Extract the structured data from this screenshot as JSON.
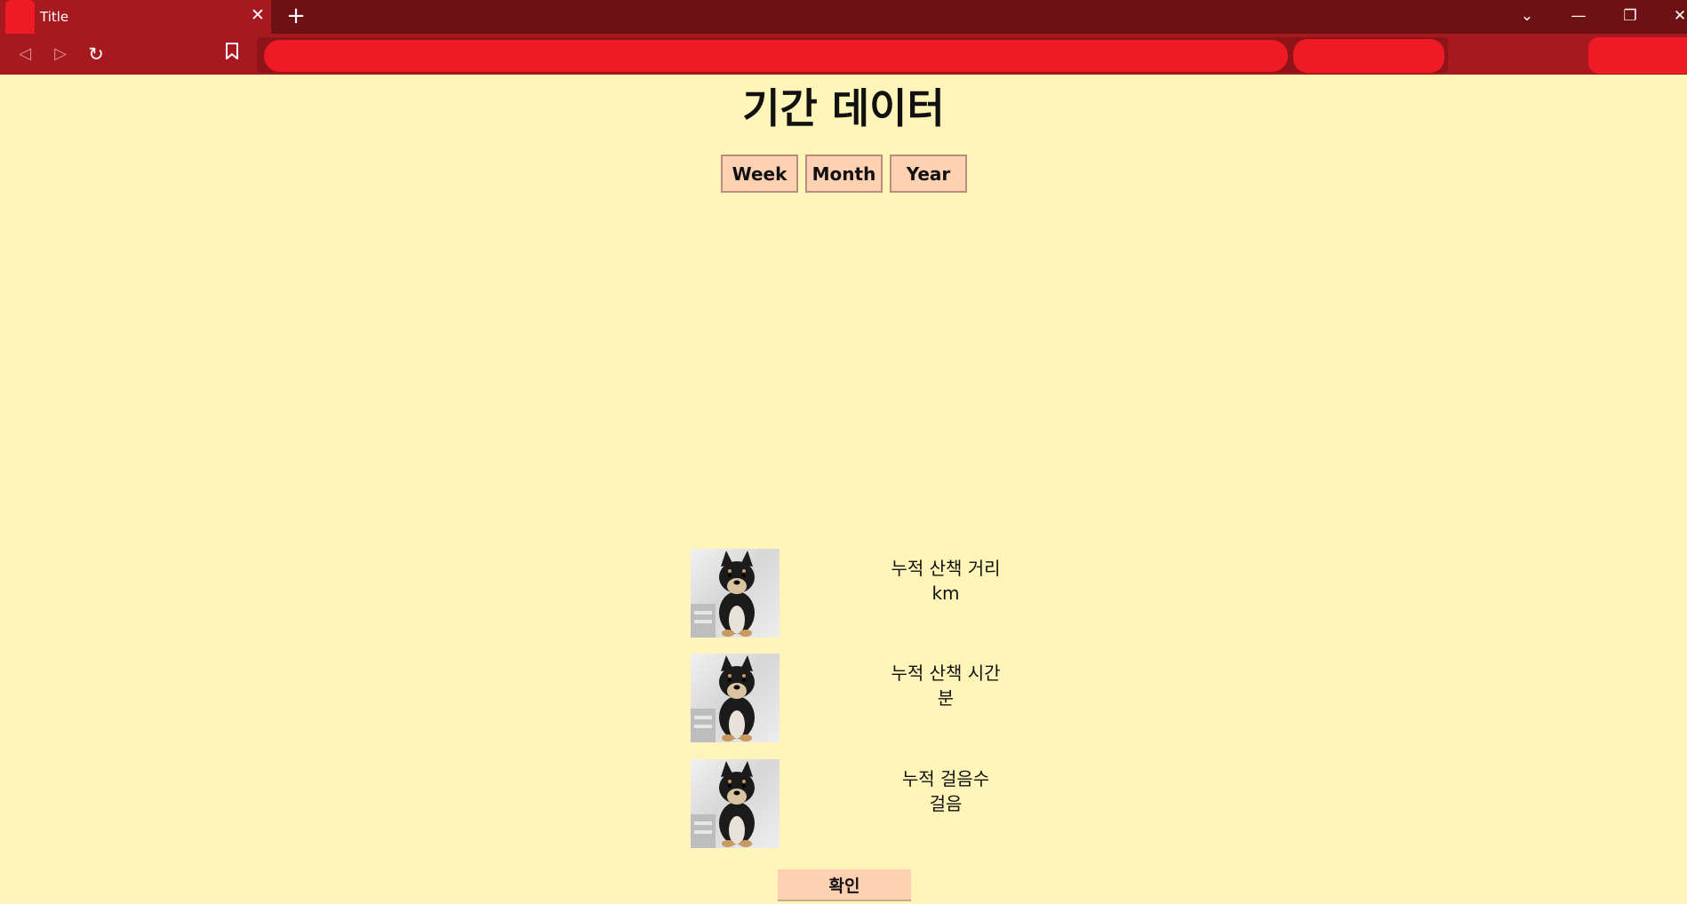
{
  "browser": {
    "tab_title": "Title",
    "tab_close_glyph": "✕",
    "new_tab_glyph": "+",
    "window_controls": {
      "dropdown_glyph": "⌄",
      "minimize_glyph": "—",
      "maximize_glyph": "❐",
      "close_glyph": "✕"
    },
    "nav": {
      "back_glyph": "◁",
      "forward_glyph": "▷",
      "reload_glyph": "↻",
      "bookmark_glyph": "🔖"
    },
    "colors": {
      "tabbar": "#6e1114",
      "toolbar": "#a5191f",
      "redaction": "#ee1b24"
    }
  },
  "page": {
    "title": "기간 데이터",
    "period_tabs": [
      {
        "label": "Week"
      },
      {
        "label": "Month"
      },
      {
        "label": "Year"
      }
    ],
    "stats": [
      {
        "label": "누적 산책 거리",
        "unit": "km"
      },
      {
        "label": "누적 산책 시간",
        "unit": "분"
      },
      {
        "label": "누적 걸음수",
        "unit": "걸음"
      }
    ],
    "confirm_label": "확인",
    "colors": {
      "background": "#fff5b8",
      "button": "#ffd1b3"
    }
  }
}
